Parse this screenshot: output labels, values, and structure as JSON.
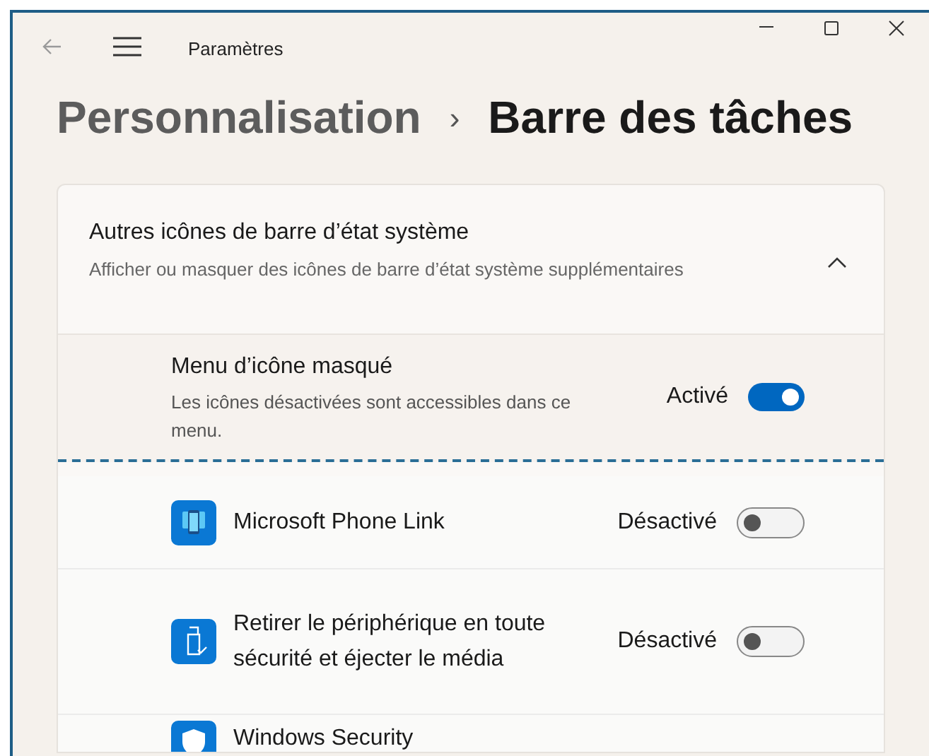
{
  "window": {
    "title": "Paramètres"
  },
  "breadcrumb": {
    "parent": "Personnalisation",
    "separator": "›",
    "current": "Barre des tâches"
  },
  "section": {
    "title": "Autres icônes de barre d’état système",
    "description": "Afficher ou masquer des icônes de barre d’état système supplémentaires",
    "expanded": true,
    "rows": [
      {
        "kind": "plain",
        "label": "Menu d’icône masqué",
        "description": "Les icônes désactivées sont accessibles dans ce menu.",
        "state_label": "Activé",
        "on": true
      },
      {
        "kind": "phone",
        "label": "Microsoft Phone Link",
        "state_label": "Désactivé",
        "on": false
      },
      {
        "kind": "drive",
        "label": "Retirer le périphérique en toute sécurité et éjecter le média",
        "state_label": "Désactivé",
        "on": false
      },
      {
        "kind": "shield",
        "label": "Windows Security"
      }
    ]
  }
}
